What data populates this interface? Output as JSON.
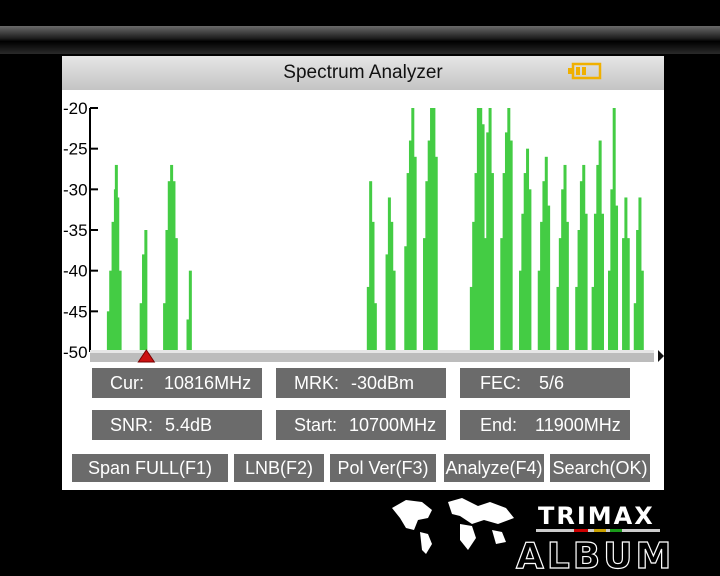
{
  "header": {
    "title": "Spectrum Analyzer",
    "battery_icon": "battery-icon"
  },
  "chart_data": {
    "type": "bar",
    "ylabel": "",
    "xlabel": "",
    "ylim": [
      -50,
      -20
    ],
    "yticks": [
      "-20",
      "-25",
      "-30",
      "-35",
      "-40",
      "-45",
      "-50"
    ],
    "x": [
      10700,
      11900
    ],
    "series_color": "#44cc44",
    "values": [
      {
        "f": 10735,
        "l": -45
      },
      {
        "f": 10740,
        "l": -40
      },
      {
        "f": 10745,
        "l": -34
      },
      {
        "f": 10750,
        "l": -30
      },
      {
        "f": 10752,
        "l": -27
      },
      {
        "f": 10755,
        "l": -31
      },
      {
        "f": 10760,
        "l": -40
      },
      {
        "f": 10805,
        "l": -44
      },
      {
        "f": 10810,
        "l": -38
      },
      {
        "f": 10815,
        "l": -35
      },
      {
        "f": 10855,
        "l": -44
      },
      {
        "f": 10860,
        "l": -35
      },
      {
        "f": 10865,
        "l": -29
      },
      {
        "f": 10870,
        "l": -27
      },
      {
        "f": 10875,
        "l": -29
      },
      {
        "f": 10880,
        "l": -36
      },
      {
        "f": 10905,
        "l": -46
      },
      {
        "f": 10910,
        "l": -40
      },
      {
        "f": 11290,
        "l": -42
      },
      {
        "f": 11295,
        "l": -29
      },
      {
        "f": 11300,
        "l": -34
      },
      {
        "f": 11305,
        "l": -44
      },
      {
        "f": 11330,
        "l": -38
      },
      {
        "f": 11335,
        "l": -31
      },
      {
        "f": 11340,
        "l": -34
      },
      {
        "f": 11345,
        "l": -40
      },
      {
        "f": 11370,
        "l": -37
      },
      {
        "f": 11375,
        "l": -28
      },
      {
        "f": 11380,
        "l": -24
      },
      {
        "f": 11385,
        "l": -20
      },
      {
        "f": 11390,
        "l": -26
      },
      {
        "f": 11410,
        "l": -36
      },
      {
        "f": 11415,
        "l": -29
      },
      {
        "f": 11420,
        "l": -24
      },
      {
        "f": 11425,
        "l": -20
      },
      {
        "f": 11430,
        "l": -20
      },
      {
        "f": 11435,
        "l": -26
      },
      {
        "f": 11510,
        "l": -42
      },
      {
        "f": 11515,
        "l": -34
      },
      {
        "f": 11520,
        "l": -28
      },
      {
        "f": 11525,
        "l": -20
      },
      {
        "f": 11530,
        "l": -20
      },
      {
        "f": 11535,
        "l": -22
      },
      {
        "f": 11540,
        "l": -36
      },
      {
        "f": 11545,
        "l": -23
      },
      {
        "f": 11550,
        "l": -20
      },
      {
        "f": 11555,
        "l": -28
      },
      {
        "f": 11575,
        "l": -36
      },
      {
        "f": 11580,
        "l": -28
      },
      {
        "f": 11585,
        "l": -23
      },
      {
        "f": 11590,
        "l": -20
      },
      {
        "f": 11595,
        "l": -24
      },
      {
        "f": 11615,
        "l": -40
      },
      {
        "f": 11620,
        "l": -33
      },
      {
        "f": 11625,
        "l": -28
      },
      {
        "f": 11630,
        "l": -25
      },
      {
        "f": 11635,
        "l": -30
      },
      {
        "f": 11655,
        "l": -40
      },
      {
        "f": 11660,
        "l": -34
      },
      {
        "f": 11665,
        "l": -29
      },
      {
        "f": 11670,
        "l": -26
      },
      {
        "f": 11675,
        "l": -32
      },
      {
        "f": 11695,
        "l": -42
      },
      {
        "f": 11700,
        "l": -36
      },
      {
        "f": 11705,
        "l": -30
      },
      {
        "f": 11710,
        "l": -27
      },
      {
        "f": 11715,
        "l": -34
      },
      {
        "f": 11735,
        "l": -42
      },
      {
        "f": 11740,
        "l": -35
      },
      {
        "f": 11745,
        "l": -29
      },
      {
        "f": 11750,
        "l": -27
      },
      {
        "f": 11755,
        "l": -33
      },
      {
        "f": 11770,
        "l": -42
      },
      {
        "f": 11775,
        "l": -33
      },
      {
        "f": 11780,
        "l": -27
      },
      {
        "f": 11785,
        "l": -24
      },
      {
        "f": 11790,
        "l": -33
      },
      {
        "f": 11805,
        "l": -40
      },
      {
        "f": 11810,
        "l": -30
      },
      {
        "f": 11815,
        "l": -20
      },
      {
        "f": 11820,
        "l": -32
      },
      {
        "f": 11835,
        "l": -36
      },
      {
        "f": 11840,
        "l": -31
      },
      {
        "f": 11845,
        "l": -36
      },
      {
        "f": 11860,
        "l": -44
      },
      {
        "f": 11865,
        "l": -35
      },
      {
        "f": 11870,
        "l": -31
      },
      {
        "f": 11875,
        "l": -40
      }
    ],
    "marker_freq": 10816
  },
  "info": {
    "cur_label": "Cur:",
    "cur_value": "10816MHz",
    "mrk_label": "MRK:",
    "mrk_value": "-30dBm",
    "fec_label": "FEC:",
    "fec_value": "5/6",
    "snr_label": "SNR:",
    "snr_value": "5.4dB",
    "start_label": "Start:",
    "start_value": "10700MHz",
    "end_label": "End:",
    "end_value": "11900MHz"
  },
  "function_keys": {
    "span": "Span FULL(F1)",
    "lnb": "LNB(F2)",
    "pol": "Pol Ver(F3)",
    "analyze": "Analyze(F4)",
    "search": "Search(OK)"
  },
  "logo": {
    "brand": "TRIMAX",
    "sub": "ALBUM"
  }
}
